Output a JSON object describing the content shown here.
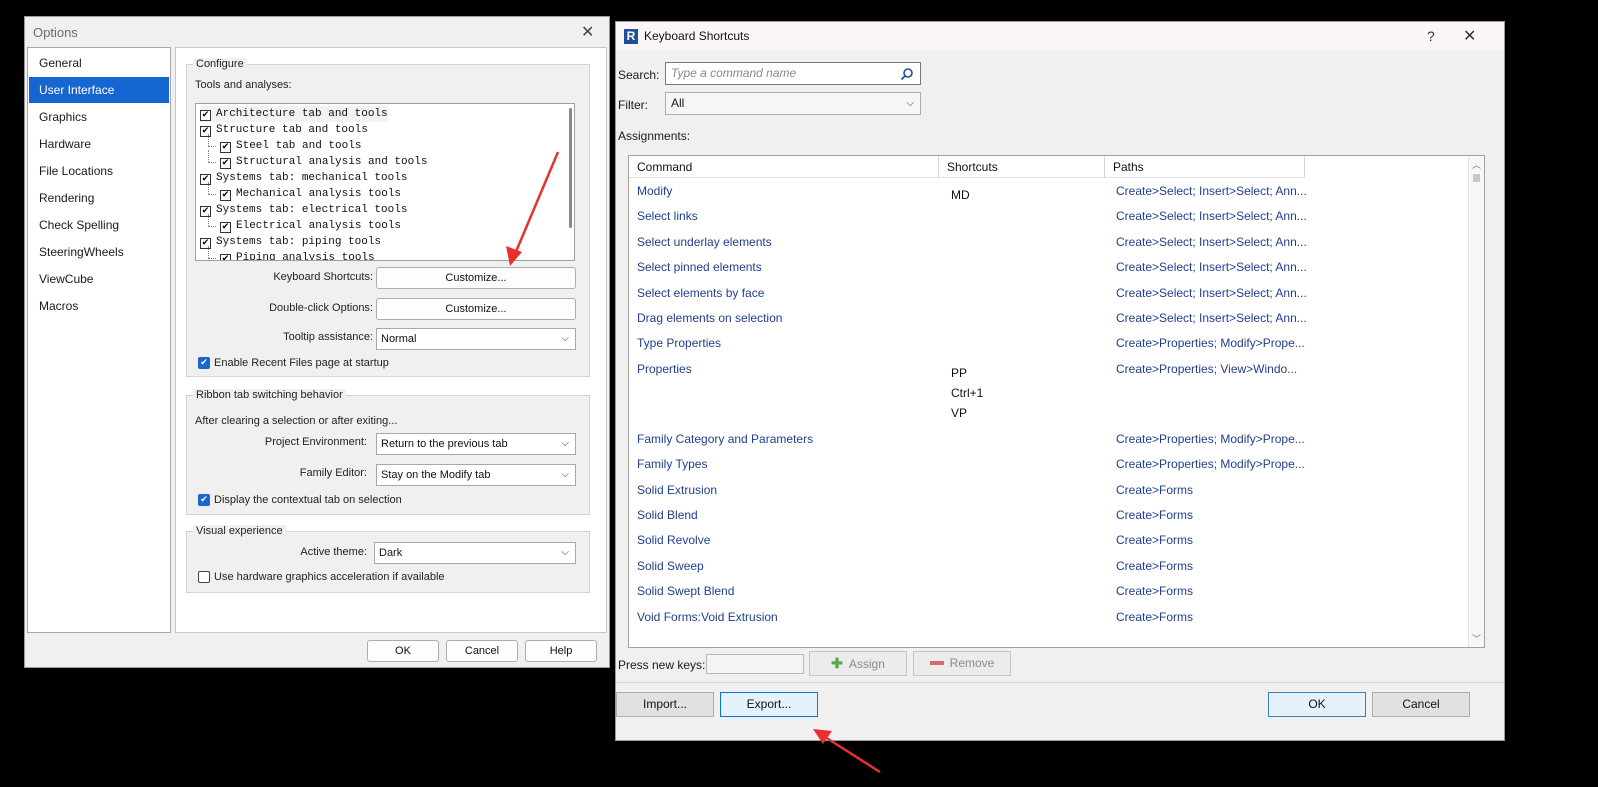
{
  "options": {
    "title": "Options",
    "nav": [
      "General",
      "User Interface",
      "Graphics",
      "Hardware",
      "File Locations",
      "Rendering",
      "Check Spelling",
      "SteeringWheels",
      "ViewCube",
      "Macros"
    ],
    "selected_nav": "User Interface",
    "configure": {
      "group_title": "Configure",
      "tools_label": "Tools and analyses:",
      "tree": [
        {
          "label": "Architecture tab and tools",
          "level": 0,
          "checked": true
        },
        {
          "label": "Structure tab and tools",
          "level": 0,
          "checked": true
        },
        {
          "label": "Steel tab and tools",
          "level": 1,
          "checked": true
        },
        {
          "label": "Structural analysis and tools",
          "level": 1,
          "checked": true
        },
        {
          "label": "Systems tab: mechanical tools",
          "level": 0,
          "checked": true
        },
        {
          "label": "Mechanical analysis tools",
          "level": 1,
          "checked": true
        },
        {
          "label": "Systems tab: electrical tools",
          "level": 0,
          "checked": true
        },
        {
          "label": "Electrical analysis tools",
          "level": 1,
          "checked": true
        },
        {
          "label": "Systems tab: piping tools",
          "level": 0,
          "checked": true
        },
        {
          "label": "Piping analysis tools",
          "level": 1,
          "checked": true
        }
      ],
      "keyboard_shortcuts_label": "Keyboard Shortcuts:",
      "keyboard_shortcuts_button": "Customize...",
      "double_click_label": "Double-click Options:",
      "double_click_button": "Customize...",
      "tooltip_label": "Tooltip assistance:",
      "tooltip_value": "Normal",
      "recent_files_label": "Enable Recent Files page at startup",
      "recent_files_checked": true
    },
    "ribbon": {
      "group_title": "Ribbon tab switching behavior",
      "after_clearing": "After clearing a selection or after exiting...",
      "project_env_label": "Project Environment:",
      "project_env_value": "Return to the previous tab",
      "family_editor_label": "Family Editor:",
      "family_editor_value": "Stay on the Modify tab",
      "contextual_label": "Display the contextual tab on selection",
      "contextual_checked": true
    },
    "visual": {
      "group_title": "Visual experience",
      "theme_label": "Active theme:",
      "theme_value": "Dark",
      "hw_accel_label": "Use hardware graphics acceleration if available",
      "hw_accel_checked": false
    },
    "buttons": {
      "ok": "OK",
      "cancel": "Cancel",
      "help": "Help"
    }
  },
  "keyboard_shortcuts": {
    "title": "Keyboard Shortcuts",
    "help_glyph": "?",
    "search_label": "Search:",
    "search_placeholder": "Type a command name",
    "filter_label": "Filter:",
    "filter_value": "All",
    "assignments_label": "Assignments:",
    "columns": [
      "Command",
      "Shortcuts",
      "Paths"
    ],
    "rows": [
      {
        "command": "Modify",
        "shortcuts": [
          "MD"
        ],
        "path": "Create>Select; Insert>Select; Ann..."
      },
      {
        "command": "Select links",
        "shortcuts": [],
        "path": "Create>Select; Insert>Select; Ann..."
      },
      {
        "command": "Select underlay elements",
        "shortcuts": [],
        "path": "Create>Select; Insert>Select; Ann..."
      },
      {
        "command": "Select pinned elements",
        "shortcuts": [],
        "path": "Create>Select; Insert>Select; Ann..."
      },
      {
        "command": "Select elements by face",
        "shortcuts": [],
        "path": "Create>Select; Insert>Select; Ann..."
      },
      {
        "command": "Drag elements on selection",
        "shortcuts": [],
        "path": "Create>Select; Insert>Select; Ann..."
      },
      {
        "command": "Type Properties",
        "shortcuts": [],
        "path": "Create>Properties; Modify>Prope..."
      },
      {
        "command": "Properties",
        "shortcuts": [
          "PP",
          "Ctrl+1",
          "VP"
        ],
        "path": "Create>Properties; View>Windo..."
      },
      {
        "command": "Family Category and Parameters",
        "shortcuts": [],
        "path": "Create>Properties; Modify>Prope..."
      },
      {
        "command": "Family Types",
        "shortcuts": [],
        "path": "Create>Properties; Modify>Prope..."
      },
      {
        "command": "Solid Extrusion",
        "shortcuts": [],
        "path": "Create>Forms"
      },
      {
        "command": "Solid Blend",
        "shortcuts": [],
        "path": "Create>Forms"
      },
      {
        "command": "Solid Revolve",
        "shortcuts": [],
        "path": "Create>Forms"
      },
      {
        "command": "Solid Sweep",
        "shortcuts": [],
        "path": "Create>Forms"
      },
      {
        "command": "Solid Swept Blend",
        "shortcuts": [],
        "path": "Create>Forms"
      },
      {
        "command": "Void Forms:Void Extrusion",
        "shortcuts": [],
        "path": "Create>Forms"
      }
    ],
    "press_new_keys_label": "Press new keys:",
    "assign_button": "Assign",
    "remove_button": "Remove",
    "import_button": "Import...",
    "export_button": "Export...",
    "ok_button": "OK",
    "cancel_button": "Cancel"
  },
  "colors": {
    "selection": "#1666d2",
    "link_text": "#1f3f8f",
    "annotation_arrow": "#e8312f"
  }
}
